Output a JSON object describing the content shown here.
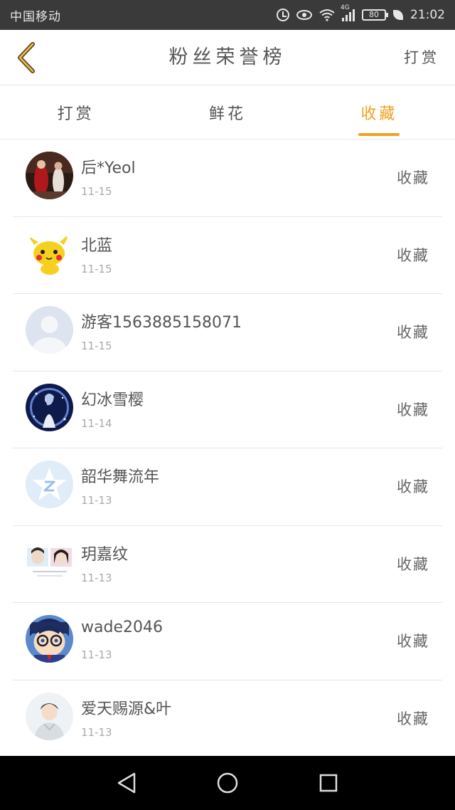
{
  "status_bar": {
    "carrier": "中国移动",
    "network": "4G",
    "battery": "80",
    "time": "21:02"
  },
  "header": {
    "title": "粉丝荣誉榜",
    "action_label": "打赏"
  },
  "tabs": [
    {
      "label": "打赏",
      "active": false
    },
    {
      "label": "鲜花",
      "active": false
    },
    {
      "label": "收藏",
      "active": true
    }
  ],
  "colors": {
    "accent": "#f0a020",
    "status_bar_bg": "#3a3a3a",
    "nav_bar_bg": "#000000"
  },
  "fans": [
    {
      "name": "后*Yeol",
      "date": "11-15",
      "type": "收藏"
    },
    {
      "name": "北蓝",
      "date": "11-15",
      "type": "收藏"
    },
    {
      "name": "游客1563885158071",
      "date": "11-15",
      "type": "收藏"
    },
    {
      "name": "幻冰雪樱",
      "date": "11-14",
      "type": "收藏"
    },
    {
      "name": "韶华舞流年",
      "date": "11-13",
      "type": "收藏"
    },
    {
      "name": "玥嘉纹",
      "date": "11-13",
      "type": "收藏"
    },
    {
      "name": "wade2046",
      "date": "11-13",
      "type": "收藏"
    },
    {
      "name": "爱天赐源&叶",
      "date": "11-13",
      "type": "收藏"
    }
  ],
  "system_nav": {
    "back": "back-triangle-icon",
    "home": "home-circle-icon",
    "recents": "recents-square-icon"
  }
}
